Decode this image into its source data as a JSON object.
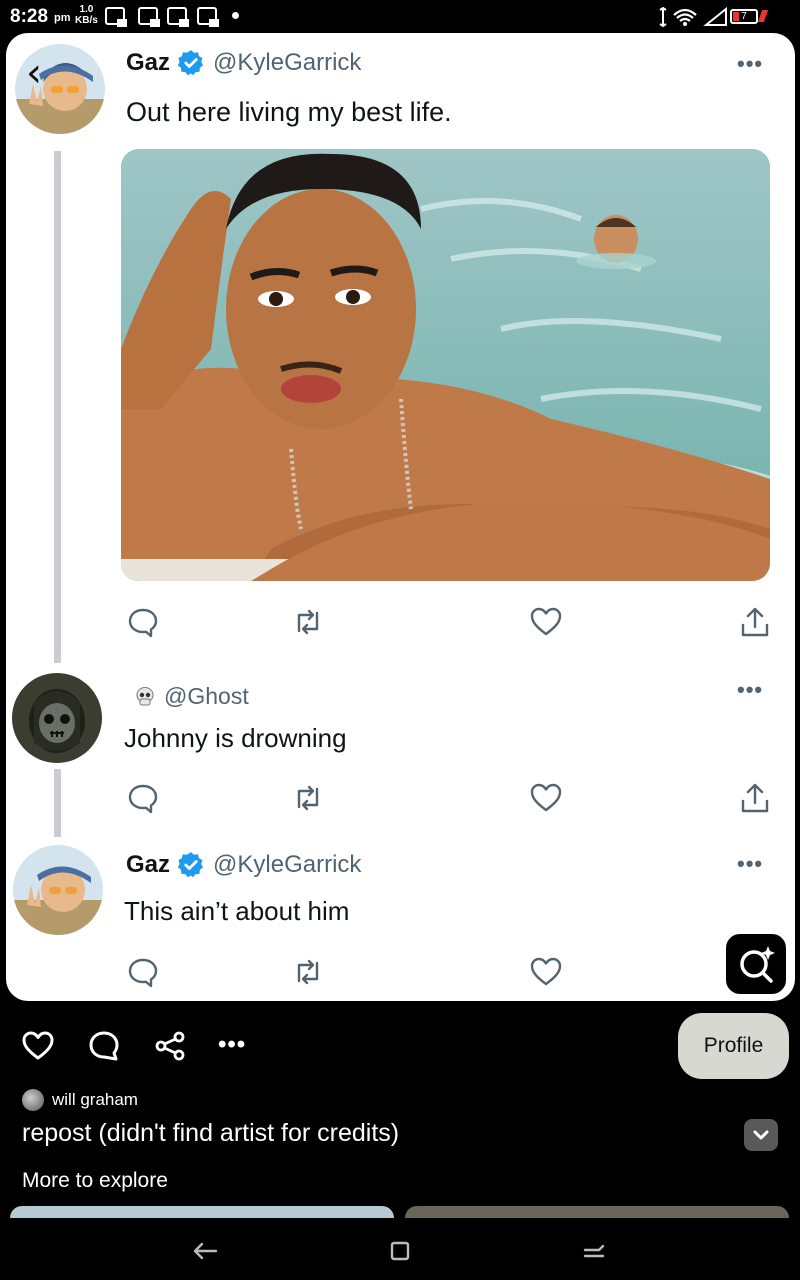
{
  "status_bar": {
    "time": "8:28",
    "ampm": "pm",
    "speed_value": "1.0",
    "speed_unit": "KB/s",
    "battery_level": "7"
  },
  "thread": [
    {
      "display_name": "Gaz",
      "handle": "@KyleGarrick",
      "verified": true,
      "text": "Out here living my best life.",
      "has_media": true
    },
    {
      "display_name": "",
      "handle": "@Ghost",
      "verified": false,
      "name_emoji_icon": "skull-icon",
      "text": "Johnny is drowning",
      "has_media": false
    },
    {
      "display_name": "Gaz",
      "handle": "@KyleGarrick",
      "verified": true,
      "text": "This ain’t about him",
      "has_media": false
    }
  ],
  "more_dots": "•••",
  "bottom_bar": {
    "profile_label": "Profile",
    "more_dots": "•••",
    "username": "will graham",
    "post_title": "repost (didn't find artist for credits)",
    "more_to_explore": "More to explore"
  },
  "colors": {
    "verified_blue": "#1d9bf0",
    "card_bg": "#ffffff",
    "text_primary": "#0f1419",
    "text_secondary": "#536471",
    "thread_line": "#c9cdd1",
    "profile_button_bg": "#d8d8d3"
  },
  "icons": [
    "back-arrow-icon",
    "reply-icon",
    "retweet-icon",
    "like-icon",
    "share-icon",
    "lens-search-icon",
    "heart-icon",
    "comment-icon",
    "share-nodes-icon",
    "chevron-down-icon"
  ]
}
